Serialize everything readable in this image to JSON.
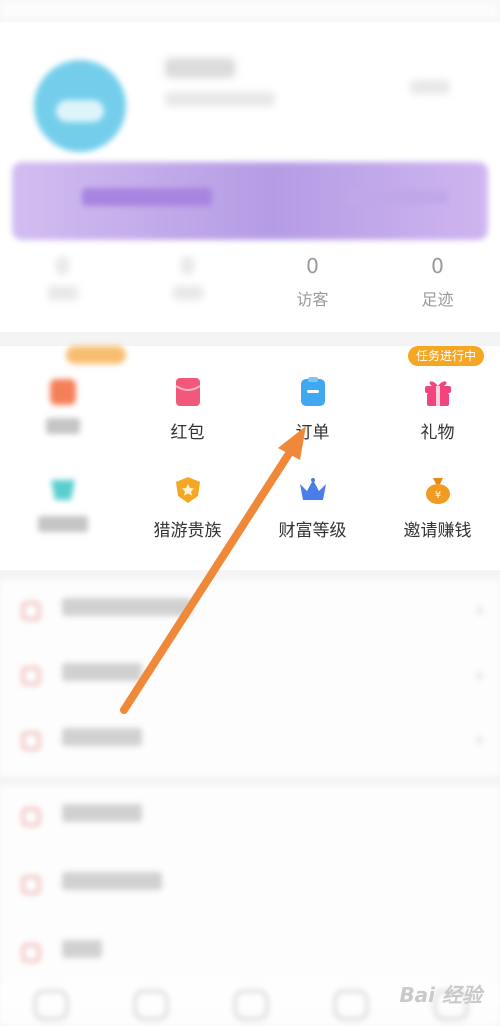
{
  "grid": {
    "task_badge": "任务进行中",
    "row1": [
      {
        "label": "",
        "icon": "orange-square-icon",
        "color": "#f26a3d"
      },
      {
        "label": "红包",
        "icon": "red-envelope-icon",
        "color": "#f2587a"
      },
      {
        "label": "订单",
        "icon": "order-clipboard-icon",
        "color": "#3fa8f0"
      },
      {
        "label": "礼物",
        "icon": "gift-icon",
        "color": "#f2457e"
      }
    ],
    "row2": [
      {
        "label": "",
        "icon": "teal-shield-icon",
        "color": "#3ec6c6"
      },
      {
        "label": "猎游贵族",
        "icon": "noble-badge-icon",
        "color": "#f5a623"
      },
      {
        "label": "财富等级",
        "icon": "crown-icon",
        "color": "#4a7de8"
      },
      {
        "label": "邀请赚钱",
        "icon": "money-bag-icon",
        "color": "#f29b23"
      }
    ]
  },
  "stats": [
    {
      "num": "0",
      "label": ""
    },
    {
      "num": "0",
      "label": ""
    },
    {
      "num": "0",
      "label": "访客"
    },
    {
      "num": "0",
      "label": "足迹"
    }
  ],
  "watermark": "Bai 经验",
  "colors": {
    "arrow": "#f0883a",
    "vip_gradient": "#a88be0",
    "task_badge": "#f5a623"
  }
}
